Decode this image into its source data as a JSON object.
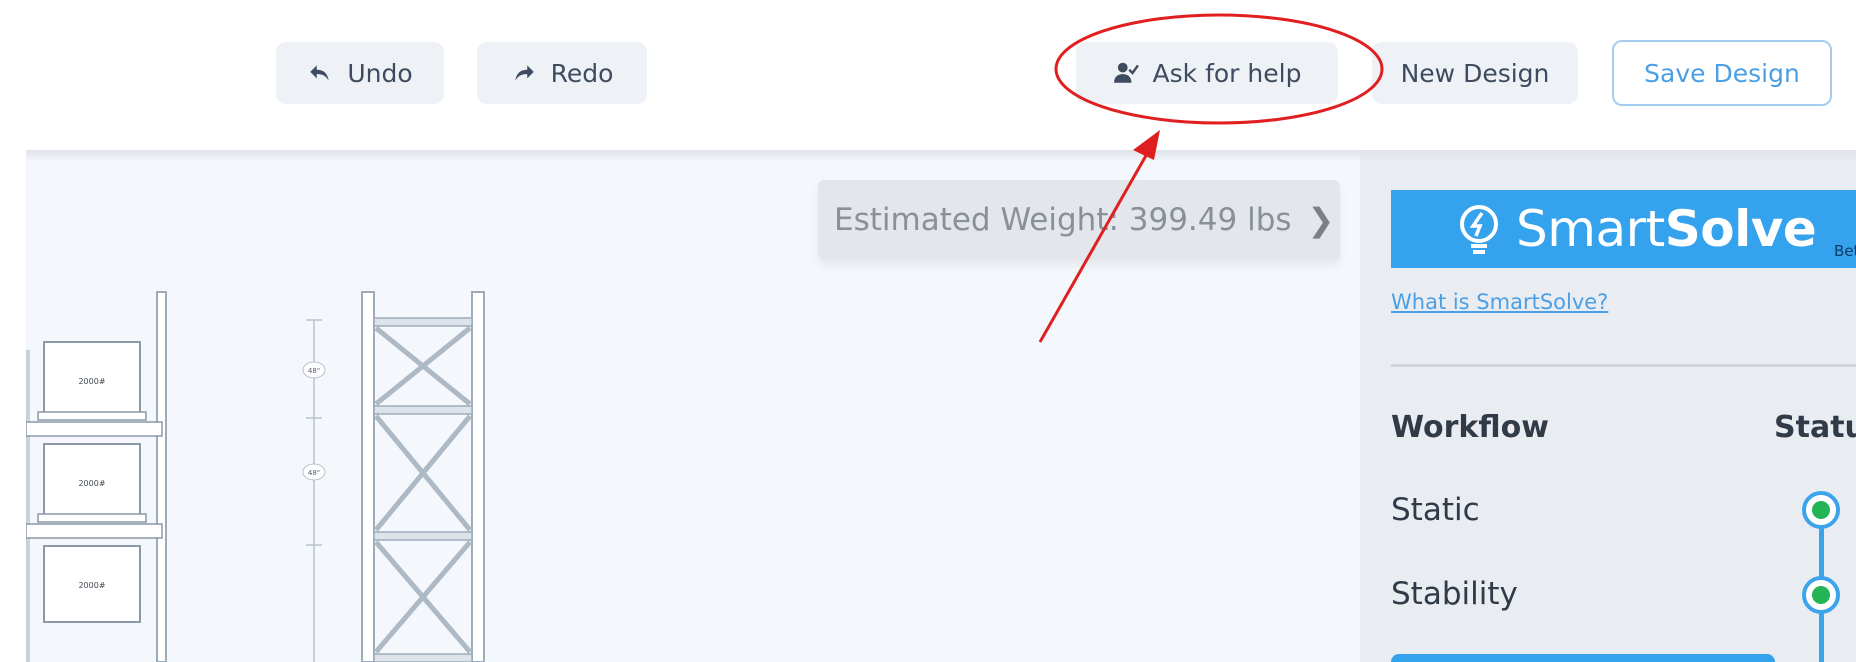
{
  "toolbar": {
    "undo_label": "Undo",
    "redo_label": "Redo",
    "help_label": "Ask for help",
    "new_design_label": "New Design",
    "save_design_label": "Save Design"
  },
  "canvas": {
    "estimated_weight": "Estimated Weight: 399.49 lbs",
    "box_labels": [
      "2000#",
      "2000#",
      "2000#"
    ],
    "dimension_labels": [
      "48\"",
      "48\""
    ]
  },
  "smartsolve": {
    "brand_light": "Smart",
    "brand_bold": "Solve",
    "beta": "Beta",
    "link": "What is SmartSolve?",
    "workflow_heading": "Workflow",
    "status_heading": "Status",
    "steps": [
      {
        "label": "Static",
        "status": "passed"
      },
      {
        "label": "Stability",
        "status": "passed"
      }
    ]
  },
  "colors": {
    "accent": "#35a2ee",
    "status_ok": "#22b455",
    "annotation": "#e02020"
  }
}
